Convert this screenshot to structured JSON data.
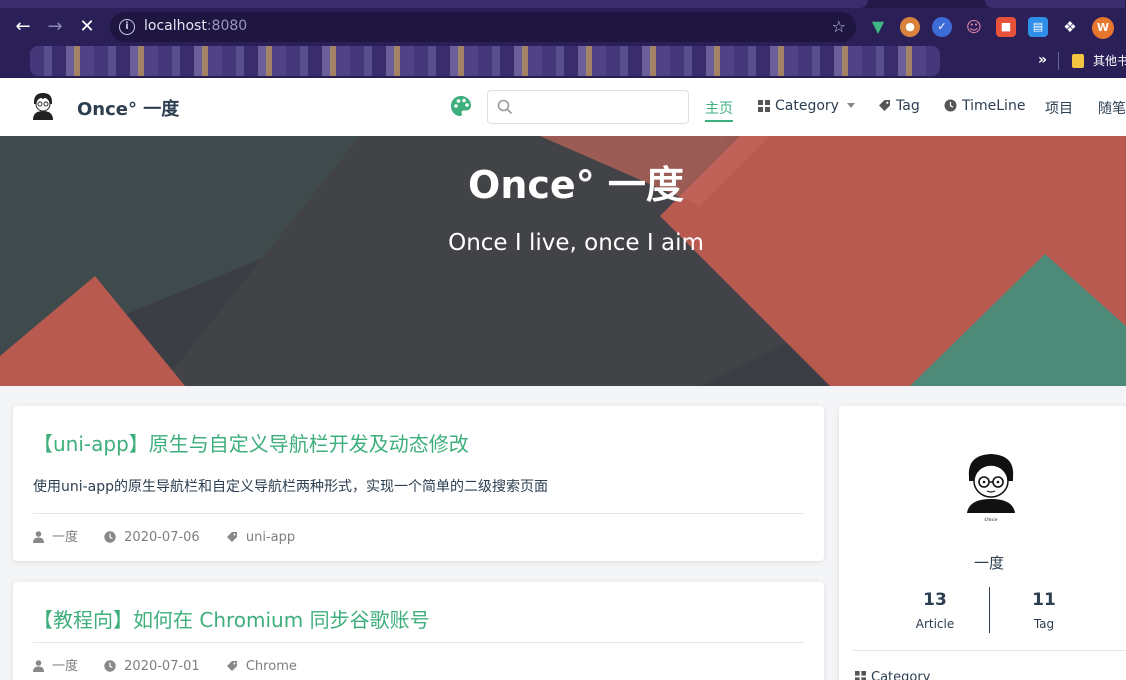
{
  "browser": {
    "url_host": "localhost",
    "url_port": ":8080",
    "bookmark_folder": "其他书签"
  },
  "site": {
    "title": "Once° 一度",
    "search_placeholder": "",
    "nav": {
      "home": "主页",
      "category": "Category",
      "tag": "Tag",
      "timeline": "TimeLine",
      "projects": "项目",
      "notes": "随笔"
    }
  },
  "hero": {
    "title": "Once° 一度",
    "subtitle": "Once I live, once I aim"
  },
  "posts": [
    {
      "title": "【uni-app】原生与自定义导航栏开发及动态修改",
      "summary": "使用uni-app的原生导航栏和自定义导航栏两种形式，实现一个简单的二级搜索页面",
      "author": "一度",
      "date": "2020-07-06",
      "tag": "uni-app"
    },
    {
      "title": "【教程向】如何在 Chromium 同步谷歌账号",
      "summary": "",
      "author": "一度",
      "date": "2020-07-01",
      "tag": "Chrome"
    }
  ],
  "profile": {
    "name": "一度",
    "articles_count": "13",
    "articles_label": "Article",
    "tags_count": "11",
    "tags_label": "Tag",
    "category_heading": "Category"
  },
  "colors": {
    "accent": "#3eaf7c",
    "hero_dark": "#3b3e44",
    "hero_red": "#b85a50",
    "hero_teal": "#4e8a78",
    "browser_frame": "#2b1f57"
  }
}
